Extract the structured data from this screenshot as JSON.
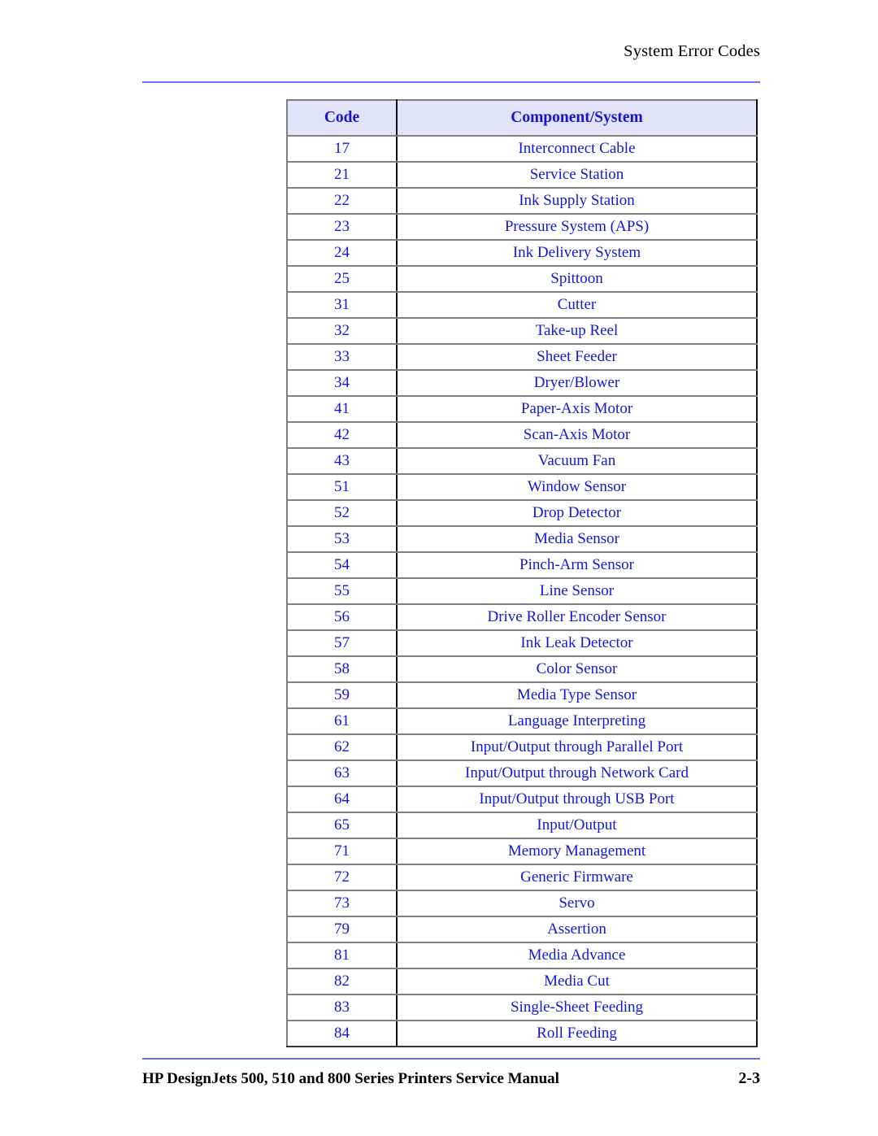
{
  "header": {
    "title": "System Error Codes"
  },
  "table": {
    "columns": [
      "Code",
      "Component/System"
    ],
    "rows": [
      {
        "code": "17",
        "component": "Interconnect Cable"
      },
      {
        "code": "21",
        "component": "Service Station"
      },
      {
        "code": "22",
        "component": "Ink Supply Station"
      },
      {
        "code": "23",
        "component": "Pressure System (APS)"
      },
      {
        "code": "24",
        "component": "Ink Delivery System"
      },
      {
        "code": "25",
        "component": "Spittoon"
      },
      {
        "code": "31",
        "component": "Cutter"
      },
      {
        "code": "32",
        "component": "Take-up Reel"
      },
      {
        "code": "33",
        "component": "Sheet Feeder"
      },
      {
        "code": "34",
        "component": "Dryer/Blower"
      },
      {
        "code": "41",
        "component": "Paper-Axis Motor"
      },
      {
        "code": "42",
        "component": "Scan-Axis Motor"
      },
      {
        "code": "43",
        "component": "Vacuum Fan"
      },
      {
        "code": "51",
        "component": "Window Sensor"
      },
      {
        "code": "52",
        "component": "Drop Detector"
      },
      {
        "code": "53",
        "component": "Media Sensor"
      },
      {
        "code": "54",
        "component": "Pinch-Arm Sensor"
      },
      {
        "code": "55",
        "component": "Line Sensor"
      },
      {
        "code": "56",
        "component": "Drive Roller Encoder Sensor"
      },
      {
        "code": "57",
        "component": "Ink Leak Detector"
      },
      {
        "code": "58",
        "component": "Color Sensor"
      },
      {
        "code": "59",
        "component": "Media Type Sensor"
      },
      {
        "code": "61",
        "component": "Language Interpreting"
      },
      {
        "code": "62",
        "component": "Input/Output through Parallel Port"
      },
      {
        "code": "63",
        "component": "Input/Output through Network Card"
      },
      {
        "code": "64",
        "component": "Input/Output through USB Port"
      },
      {
        "code": "65",
        "component": "Input/Output"
      },
      {
        "code": "71",
        "component": "Memory Management"
      },
      {
        "code": "72",
        "component": "Generic Firmware"
      },
      {
        "code": "73",
        "component": "Servo"
      },
      {
        "code": "79",
        "component": "Assertion"
      },
      {
        "code": "81",
        "component": "Media Advance"
      },
      {
        "code": "82",
        "component": "Media Cut"
      },
      {
        "code": "83",
        "component": "Single-Sheet Feeding"
      },
      {
        "code": "84",
        "component": "Roll Feeding"
      }
    ]
  },
  "footer": {
    "text": "HP DesignJets 500, 510 and 800 Series Printers Service Manual",
    "page_number": "2-3"
  },
  "colors": {
    "rule": "#6b72f0",
    "header_fill": "#e2e2f8",
    "text_blue": "#1515d8",
    "row_border": "#808080",
    "column_divider": "#111111"
  }
}
